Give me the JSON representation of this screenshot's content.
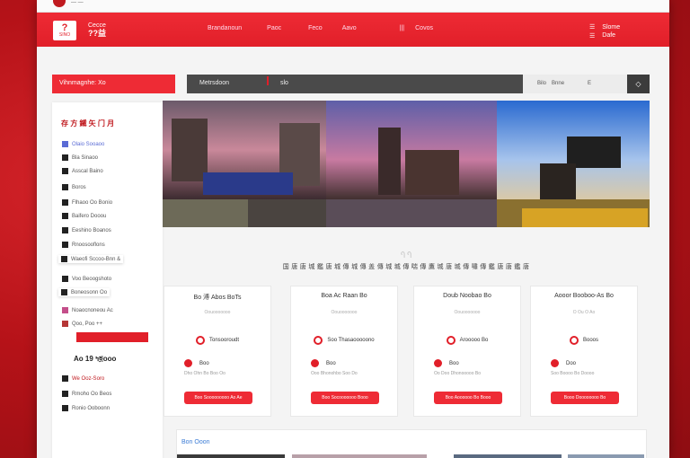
{
  "top_strip": {
    "text": "— —"
  },
  "header": {
    "logo_glyph": "?",
    "logo_small": "SINO",
    "brand_line1": "Cecce",
    "brand_line2": "??益",
    "nav": [
      "Brandanoun",
      "Paoc",
      "Feco",
      "Aavo",
      "|||",
      "Covos"
    ],
    "icons": [
      "menu-icon",
      "list-icon"
    ],
    "icon_text": [
      "Slome",
      "Dafe"
    ]
  },
  "search": {
    "category_button": "Vihnmagnhe: Xo",
    "label": "Metrsdoon",
    "query": "slo",
    "right_text": [
      "Bilo",
      "Bnne",
      "E"
    ],
    "go_label": "◇"
  },
  "sidebar": {
    "heading": "存 ⽅ 鐵 ⽮ ⻔ ⽉",
    "items": [
      "Olaio Sooaoo",
      "Bla Sinaoo",
      "Asscal Baino",
      "Boros",
      "Flhaoo Oo Bonio",
      "Baifero Dooou",
      "Eeshino Boanos",
      "Rnoosooflons",
      "Waeofi Sccoo-Bnn &",
      "Voo Beoogshoto",
      "Boneosonn Oo",
      "Noaocnoneou Ac",
      "Qoo, Poo ++"
    ],
    "sub_heading": "Ao 19 ߤ፬ooo",
    "bottom_items": [
      "We Ooz-Soro",
      "Rmoho Oo Beos",
      "Ronio Ooboonn"
    ]
  },
  "mid": {
    "deco": "Ⴄ Ⴄ",
    "heading": "国 唐 唐 城 鑑 唐 城 傳 城 傳 盖 傳 城 城 傳 喘 傳 鷹 城 唐 城 傳 嘯 傳 鑑 唐 唐 鑑 唐"
  },
  "cards": [
    {
      "title": "Bo 溥 Abos BoTs",
      "sub": "Oouooooooo",
      "icon_label": "Tonsooroudt",
      "price": "Boo",
      "line": "Dho Ohn Bo Boo Oo",
      "button": "Boo Sooooooooo Ao Ae"
    },
    {
      "title": "Boa Ac Raan Bo",
      "sub": "Oouooooooo",
      "icon_label": "Soo Thasaooooono",
      "price": "Boo",
      "line": "Ooo Bhonohbo Soo Do",
      "button": "Boo Socooooooo Booo"
    },
    {
      "title": "Doub Noobao Bo",
      "sub": "Oouooooooo",
      "icon_label": "Arooooo Bo",
      "price": "Boo",
      "line": "Oo Doo Dhonooooo Bo",
      "button": "Boo Aoooooo Bo Booo"
    },
    {
      "title": "Aooor Booboo-As Bo",
      "sub": "O Ou O Ao",
      "icon_label": "Booos",
      "price": "Doo",
      "line": "Soo Boooo Bo Doooo",
      "button": "Booo Doooooooo Bo"
    }
  ],
  "bottom": {
    "title": "Bon Ooon"
  },
  "colors": {
    "accent": "#e11f29",
    "background_frame": "#b51218",
    "dark_bar": "#4a4a4a"
  }
}
